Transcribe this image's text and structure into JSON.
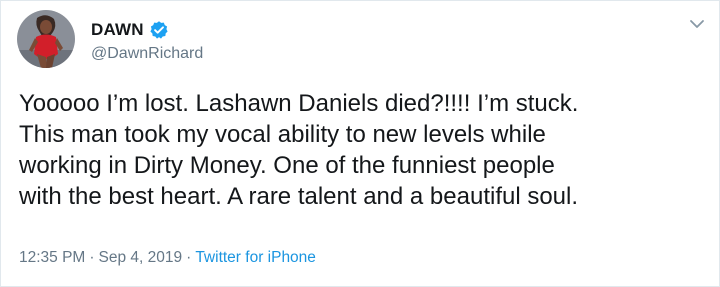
{
  "author": {
    "name": "DAWN",
    "handle": "@DawnRichard",
    "verified": true
  },
  "tweet": {
    "text": "Yooooo I’m lost. Lashawn Daniels died?!!!! I’m stuck.\nThis man took my vocal ability to new levels while\nworking in Dirty Money. One of the funniest people\nwith the best heart. A rare talent and a beautiful soul.",
    "time": "12:35 PM",
    "separator": "·",
    "date": "Sep 4, 2019",
    "source": "Twitter for iPhone"
  },
  "icons": {
    "verified": "verified-badge-icon",
    "menu": "chevron-down-icon"
  },
  "colors": {
    "text": "#14171a",
    "secondary": "#657786",
    "link": "#1b95e0",
    "verified": "#1da1f2"
  }
}
